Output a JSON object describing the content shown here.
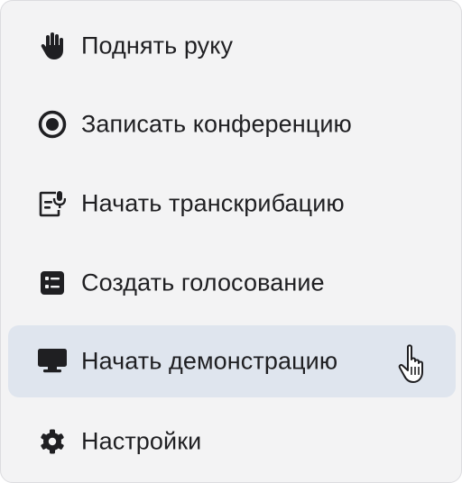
{
  "menu": {
    "items": [
      {
        "label": "Поднять руку",
        "icon": "raise-hand-icon"
      },
      {
        "label": "Записать конференцию",
        "icon": "record-icon"
      },
      {
        "label": "Начать транскрибацию",
        "icon": "transcribe-icon"
      },
      {
        "label": "Создать голосование",
        "icon": "poll-icon"
      },
      {
        "label": "Начать демонстрацию",
        "icon": "screen-share-icon",
        "active": true
      },
      {
        "label": "Настройки",
        "icon": "settings-icon"
      }
    ],
    "active_background": "#dfe5ee",
    "panel_background": "#f3f3f4",
    "icon_color": "#1f1f22"
  }
}
